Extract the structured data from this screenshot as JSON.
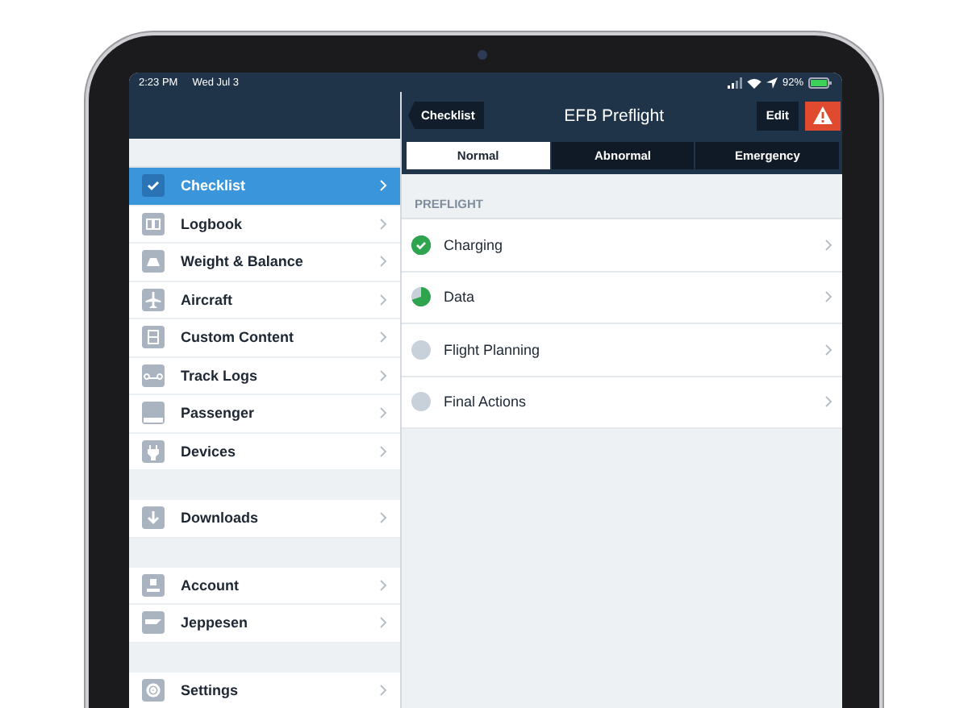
{
  "status_bar": {
    "time": "2:23 PM",
    "date": "Wed Jul 3",
    "battery": "92%"
  },
  "nav_bar": {
    "back": "Checklist",
    "title": "EFB Preflight",
    "edit": "Edit"
  },
  "tabs": [
    {
      "label": "Normal",
      "selected": true
    },
    {
      "label": "Abnormal",
      "selected": false
    },
    {
      "label": "Emergency",
      "selected": false
    }
  ],
  "sidebar": {
    "groups": [
      [
        {
          "label": "Checklist",
          "selected": true
        },
        {
          "label": "Logbook",
          "selected": false
        },
        {
          "label": "Weight & Balance",
          "selected": false
        },
        {
          "label": "Aircraft",
          "selected": false
        },
        {
          "label": "Custom Content",
          "selected": false
        },
        {
          "label": "Track Logs",
          "selected": false
        },
        {
          "label": "Passenger",
          "selected": false
        },
        {
          "label": "Devices",
          "selected": false
        }
      ],
      [
        {
          "label": "Downloads",
          "selected": false
        }
      ],
      [
        {
          "label": "Account",
          "selected": false
        },
        {
          "label": "Jeppesen",
          "selected": false
        }
      ],
      [
        {
          "label": "Settings",
          "selected": false
        }
      ]
    ]
  },
  "section": {
    "title": "PREFLIGHT",
    "items": [
      {
        "label": "Charging",
        "started": true,
        "done": true
      },
      {
        "label": "Data",
        "started": true,
        "done": false
      },
      {
        "label": "Flight Planning",
        "started": false,
        "done": false
      },
      {
        "label": "Final Actions",
        "started": false,
        "done": false
      }
    ]
  }
}
